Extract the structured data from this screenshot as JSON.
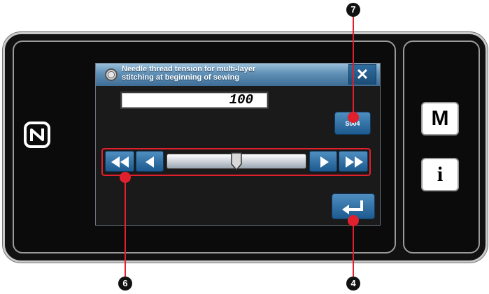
{
  "dialog": {
    "title_line1": "Needle thread tension for multi-layer",
    "title_line2": "stitching at beginning of sewing",
    "close_label": "✕",
    "icon": "thread-spool-icon"
  },
  "value": "100",
  "memory_button": {
    "label": "S004"
  },
  "slider": {
    "level_fraction": 0.5,
    "buttons": [
      "fast-rewind-icon",
      "step-left-icon",
      "step-right-icon",
      "fast-forward-icon"
    ]
  },
  "enter_button": {
    "icon": "enter-return-icon"
  },
  "side_buttons": {
    "m_label": "M",
    "info_label": "i"
  },
  "nfc_icon": "nfc-n-icon",
  "callouts": {
    "memory": "7",
    "slider": "6",
    "enter": "4"
  },
  "colors": {
    "accent_red": "#e0202d",
    "button_blue": "#1d5a8f",
    "title_bar_blue": "#5f8fb4"
  }
}
